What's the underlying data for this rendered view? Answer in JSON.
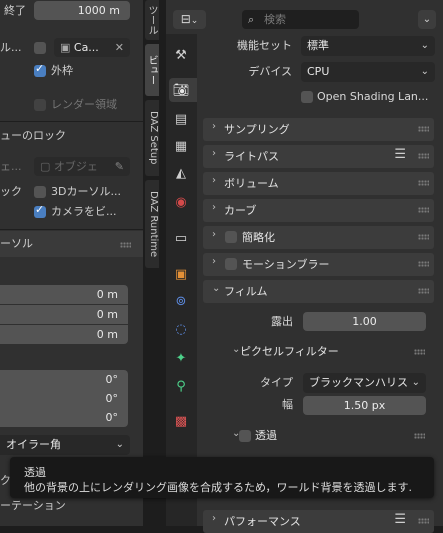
{
  "left": {
    "end_label": "終了",
    "end_value": "1000 m",
    "cam_row_label": "ル...",
    "cam_field": "Ca...",
    "outer_frame": "外枠",
    "render_region": "レンダー領域",
    "view_lock_header": "ューのロック",
    "object_row_label": "ェ...",
    "object_field": "オブジェ",
    "lock_label": "ック",
    "cursor_3d": "3Dカーソル...",
    "camera_view": "カメラをビ...",
    "cursor_header": "ーソル",
    "loc_values": [
      "0 m",
      "0 m",
      "0 m"
    ],
    "rot_values": [
      "0°",
      "0°",
      "0°"
    ],
    "euler": "オイラー角",
    "bottom_cut1": "ク...",
    "bottom_cut2": "ーテーション"
  },
  "vtabs": [
    "ツール",
    "ビュー",
    "DAZ Setup",
    "DAZ Runtime"
  ],
  "header": {
    "search_placeholder": "検索"
  },
  "props": {
    "feature_set_label": "機能セット",
    "feature_set_value": "標準",
    "device_label": "デバイス",
    "device_value": "CPU",
    "osl_label": "Open Shading Lan...",
    "sections": {
      "sampling": "サンプリング",
      "light_paths": "ライトパス",
      "volumes": "ボリューム",
      "curves": "カーブ",
      "simplify": "簡略化",
      "motion_blur": "モーションブラー",
      "film": "フィルム",
      "performance": "パフォーマンス"
    },
    "exposure_label": "露出",
    "exposure_value": "1.00",
    "pixel_filter": "ピクセルフィルター",
    "type_label": "タイプ",
    "type_value": "ブラックマンハリス",
    "width_label": "幅",
    "width_value": "1.50 px",
    "transparent": "透過"
  },
  "tooltip": {
    "title": "透過",
    "body": "他の背景の上にレンダリング画像を合成するため，ワールド背景を透過します."
  },
  "colors": {
    "accent": "#4a7fc1",
    "panel_bg": "#303030",
    "section_bg": "#3c3c3c"
  },
  "icons": [
    "tool-icon",
    "render-icon",
    "output-icon",
    "view-layer-icon",
    "scene-icon",
    "world-icon",
    "collection-icon",
    "object-icon",
    "modifier-icon",
    "particles-icon",
    "physics-icon",
    "constraints-icon",
    "data-icon",
    "material-icon"
  ]
}
